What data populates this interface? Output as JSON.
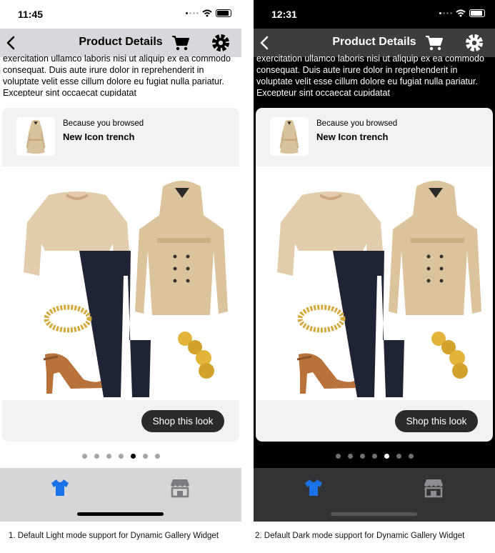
{
  "light": {
    "status": {
      "time": "11:45"
    },
    "nav": {
      "title": "Product Details"
    },
    "description": "exercitation ullamco laboris nisi ut aliquip ex ea commodo consequat. Duis aute irure dolor in reprehenderit in voluptate velit esse cillum dolore eu fugiat nulla pariatur. Excepteur sint occaecat cupidatat",
    "card": {
      "because_label": "Because you browsed",
      "product_name": "New Icon trench",
      "button_label": "Shop this look"
    },
    "pager": {
      "count": 7,
      "active_index": 4
    },
    "colors": {
      "accent": "#1a73e8",
      "nav_bar": "#d8d8dc",
      "tab_bar": "#d6d6d9"
    },
    "icons": [
      "back-chevron-icon",
      "cart-icon",
      "gear-icon",
      "shirt-icon",
      "store-icon"
    ],
    "caption": "1. Default Light mode support for Dynamic Gallery Widget"
  },
  "dark": {
    "status": {
      "time": "12:31"
    },
    "nav": {
      "title": "Product Details"
    },
    "description": "exercitation ullamco laboris nisi ut aliquip ex ea commodo consequat. Duis aute irure dolor in reprehenderit in voluptate velit esse cillum dolore eu fugiat nulla pariatur. Excepteur sint occaecat cupidatat",
    "card": {
      "because_label": "Because you browsed",
      "product_name": "New Icon trench",
      "button_label": "Shop this look"
    },
    "pager": {
      "count": 7,
      "active_index": 4
    },
    "colors": {
      "accent": "#1a73e8",
      "nav_bar": "#3d3d3f",
      "tab_bar": "#333335"
    },
    "icons": [
      "back-chevron-icon",
      "cart-icon",
      "gear-icon",
      "shirt-icon",
      "store-icon"
    ],
    "caption": "2. Default Dark mode support for Dynamic Gallery Widget"
  }
}
